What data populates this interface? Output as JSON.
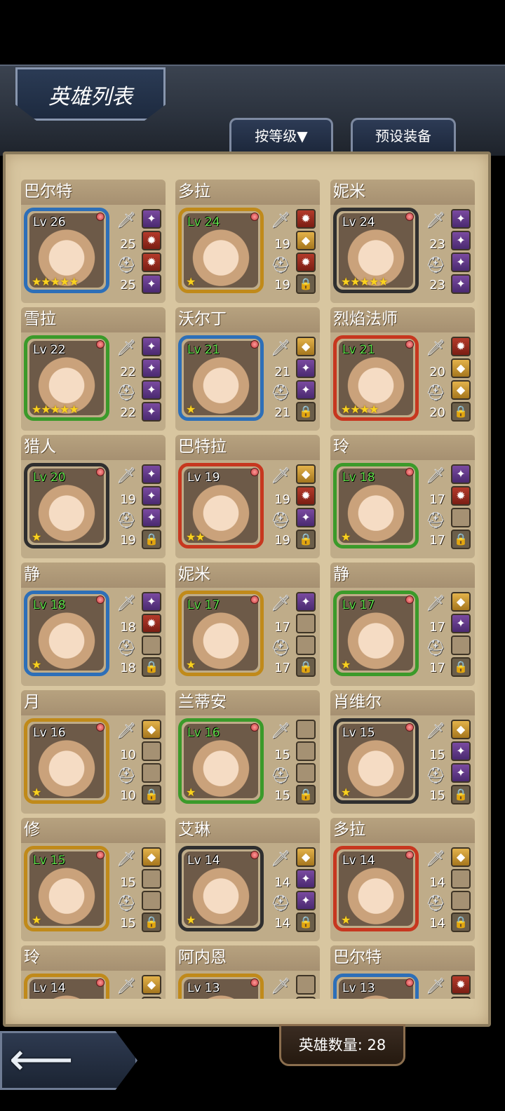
{
  "header": {
    "title": "英雄列表",
    "sort_label": "按等级▼",
    "preset_label": "预设装备"
  },
  "footer": {
    "hero_count": "英雄数量: 28"
  },
  "heroes": [
    {
      "name": "巴尔特",
      "lv": "Lv 26",
      "stars": "★★★★★",
      "attack": "25",
      "defense": "25",
      "lv_color": "white",
      "frame": "#2d6fb8",
      "slots": [
        "eq",
        "red",
        "red",
        "eq"
      ]
    },
    {
      "name": "多拉",
      "lv": "Lv 24",
      "stars": "★",
      "attack": "19",
      "defense": "19",
      "lv_color": "green",
      "frame": "#c08a1a",
      "slots": [
        "red",
        "gold",
        "red",
        "lock"
      ]
    },
    {
      "name": "妮米",
      "lv": "Lv 24",
      "stars": "★★★★★",
      "attack": "23",
      "defense": "23",
      "lv_color": "white",
      "frame": "#2f2f2f",
      "slots": [
        "eq",
        "eq",
        "eq",
        "eq"
      ]
    },
    {
      "name": "雪拉",
      "lv": "Lv 22",
      "stars": "★★★★★",
      "attack": "22",
      "defense": "22",
      "lv_color": "white",
      "frame": "#3b9a2a",
      "slots": [
        "eq",
        "eq",
        "eq",
        "eq"
      ]
    },
    {
      "name": "沃尔丁",
      "lv": "Lv 21",
      "stars": "★",
      "attack": "21",
      "defense": "21",
      "lv_color": "green",
      "frame": "#2d6fb8",
      "slots": [
        "gold",
        "eq",
        "eq",
        "lock"
      ]
    },
    {
      "name": "烈焰法师",
      "lv": "Lv 21",
      "stars": "★★★★",
      "attack": "20",
      "defense": "20",
      "lv_color": "green",
      "frame": "#c7371f",
      "slots": [
        "red",
        "gold",
        "gold",
        "lock"
      ]
    },
    {
      "name": "猎人",
      "lv": "Lv 20",
      "stars": "★",
      "attack": "19",
      "defense": "19",
      "lv_color": "green",
      "frame": "#2f2f2f",
      "slots": [
        "eq",
        "eq",
        "eq",
        "lock"
      ]
    },
    {
      "name": "巴特拉",
      "lv": "Lv 19",
      "stars": "★★",
      "attack": "19",
      "defense": "19",
      "lv_color": "white",
      "frame": "#c7371f",
      "slots": [
        "gold",
        "red",
        "eq",
        "lock"
      ]
    },
    {
      "name": "玲",
      "lv": "Lv 18",
      "stars": "★",
      "attack": "17",
      "defense": "17",
      "lv_color": "green",
      "frame": "#3b9a2a",
      "slots": [
        "eq",
        "red",
        "empty",
        "lock"
      ]
    },
    {
      "name": "静",
      "lv": "Lv 18",
      "stars": "★",
      "attack": "18",
      "defense": "18",
      "lv_color": "green",
      "frame": "#2d6fb8",
      "slots": [
        "eq",
        "red",
        "empty",
        "lock"
      ]
    },
    {
      "name": "妮米",
      "lv": "Lv 17",
      "stars": "★",
      "attack": "17",
      "defense": "17",
      "lv_color": "green",
      "frame": "#c08a1a",
      "slots": [
        "eq",
        "empty",
        "empty",
        "lock"
      ]
    },
    {
      "name": "静",
      "lv": "Lv 17",
      "stars": "★",
      "attack": "17",
      "defense": "17",
      "lv_color": "green",
      "frame": "#3b9a2a",
      "slots": [
        "gold",
        "eq",
        "empty",
        "lock"
      ]
    },
    {
      "name": "月",
      "lv": "Lv 16",
      "stars": "★",
      "attack": "10",
      "defense": "10",
      "lv_color": "white",
      "frame": "#c08a1a",
      "slots": [
        "gold",
        "empty",
        "empty",
        "lock"
      ]
    },
    {
      "name": "兰蒂安",
      "lv": "Lv 16",
      "stars": "★",
      "attack": "15",
      "defense": "15",
      "lv_color": "green",
      "frame": "#3b9a2a",
      "slots": [
        "empty",
        "empty",
        "empty",
        "lock"
      ]
    },
    {
      "name": "肖维尔",
      "lv": "Lv 15",
      "stars": "★",
      "attack": "15",
      "defense": "15",
      "lv_color": "white",
      "frame": "#2f2f2f",
      "slots": [
        "gold",
        "eq",
        "eq",
        "lock"
      ]
    },
    {
      "name": "修",
      "lv": "Lv 15",
      "stars": "★",
      "attack": "15",
      "defense": "15",
      "lv_color": "green",
      "frame": "#c08a1a",
      "slots": [
        "gold",
        "empty",
        "empty",
        "lock"
      ]
    },
    {
      "name": "艾琳",
      "lv": "Lv 14",
      "stars": "★",
      "attack": "14",
      "defense": "14",
      "lv_color": "white",
      "frame": "#2f2f2f",
      "slots": [
        "gold",
        "eq",
        "eq",
        "lock"
      ]
    },
    {
      "name": "多拉",
      "lv": "Lv 14",
      "stars": "★",
      "attack": "14",
      "defense": "14",
      "lv_color": "white",
      "frame": "#c7371f",
      "slots": [
        "gold",
        "empty",
        "empty",
        "lock"
      ]
    },
    {
      "name": "玲",
      "lv": "Lv 14",
      "stars": "",
      "attack": "",
      "defense": "",
      "lv_color": "white",
      "frame": "#c08a1a",
      "slots": [
        "gold",
        "empty",
        "empty",
        "empty"
      ]
    },
    {
      "name": "阿内恩",
      "lv": "Lv 13",
      "stars": "",
      "attack": "",
      "defense": "",
      "lv_color": "white",
      "frame": "#c08a1a",
      "slots": [
        "empty",
        "empty",
        "empty",
        "empty"
      ]
    },
    {
      "name": "巴尔特",
      "lv": "Lv 13",
      "stars": "",
      "attack": "",
      "defense": "",
      "lv_color": "white",
      "frame": "#2d6fb8",
      "slots": [
        "red",
        "empty",
        "empty",
        "empty"
      ]
    }
  ]
}
